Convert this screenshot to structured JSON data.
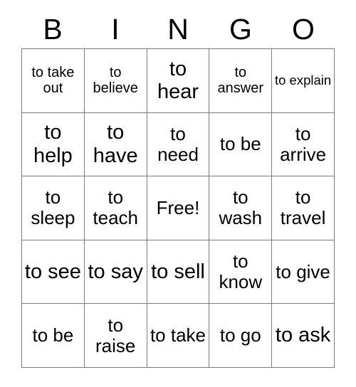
{
  "card": {
    "title": "BINGO",
    "columns": [
      "B",
      "I",
      "N",
      "G",
      "O"
    ],
    "border_color": "#7d7d7d",
    "text_color": "#000000",
    "background_color": "#ffffff",
    "free_space_label": "Free!",
    "rows": [
      [
        {
          "label": "to take out",
          "size": "sm",
          "free": false
        },
        {
          "label": "to believe",
          "size": "sm",
          "free": false
        },
        {
          "label": "to hear",
          "size": "lg",
          "free": false
        },
        {
          "label": "to answer",
          "size": "sm",
          "free": false
        },
        {
          "label": "to explain",
          "size": "xs",
          "free": false
        }
      ],
      [
        {
          "label": "to help",
          "size": "lg",
          "free": false
        },
        {
          "label": "to have",
          "size": "lg",
          "free": false
        },
        {
          "label": "to need",
          "size": "md",
          "free": false
        },
        {
          "label": "to be",
          "size": "md",
          "free": false
        },
        {
          "label": "to arrive",
          "size": "md",
          "free": false
        }
      ],
      [
        {
          "label": "to sleep",
          "size": "md",
          "free": false
        },
        {
          "label": "to teach",
          "size": "md",
          "free": false
        },
        {
          "label": "Free!",
          "size": "md",
          "free": true
        },
        {
          "label": "to wash",
          "size": "md",
          "free": false
        },
        {
          "label": "to travel",
          "size": "md",
          "free": false
        }
      ],
      [
        {
          "label": "to see",
          "size": "lg",
          "free": false
        },
        {
          "label": "to say",
          "size": "lg",
          "free": false
        },
        {
          "label": "to sell",
          "size": "lg",
          "free": false
        },
        {
          "label": "to know",
          "size": "md",
          "free": false
        },
        {
          "label": "to give",
          "size": "md",
          "free": false
        }
      ],
      [
        {
          "label": "to be",
          "size": "md",
          "free": false
        },
        {
          "label": "to raise",
          "size": "md",
          "free": false
        },
        {
          "label": "to take",
          "size": "md",
          "free": false
        },
        {
          "label": "to go",
          "size": "md",
          "free": false
        },
        {
          "label": "to ask",
          "size": "lg",
          "free": false
        }
      ]
    ]
  }
}
